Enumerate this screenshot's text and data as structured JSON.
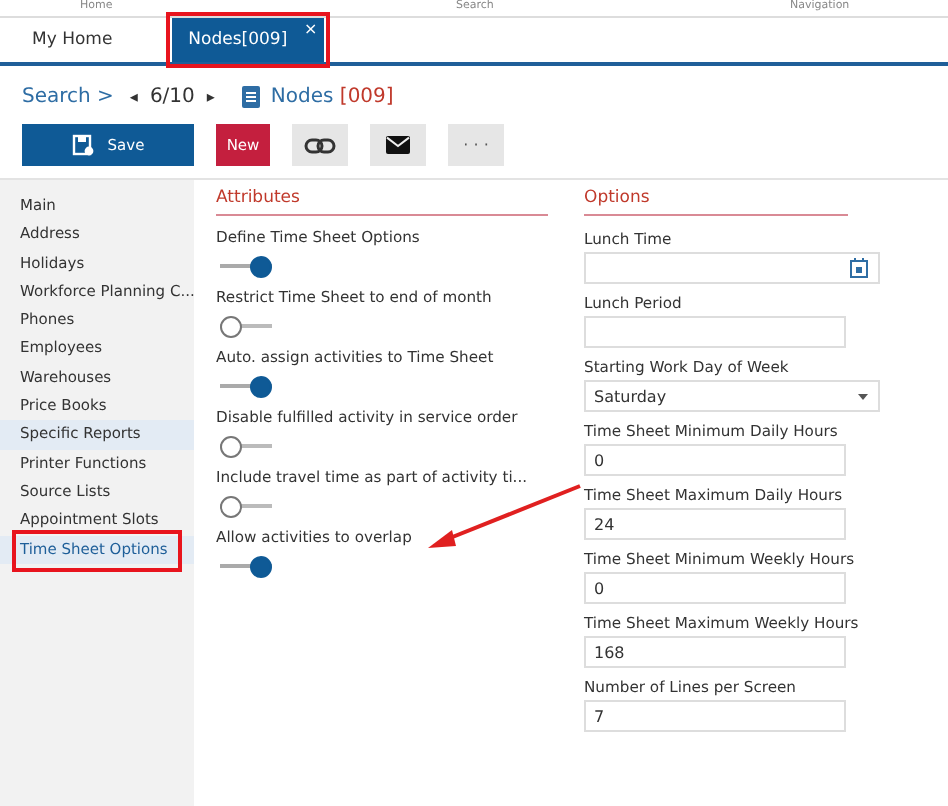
{
  "ribbon_groups": [
    "Home",
    "Search",
    "Navigation"
  ],
  "tabs": [
    {
      "label": "My Home",
      "selected": false
    },
    {
      "label": "Nodes[009]",
      "selected": true,
      "close_glyph": "×"
    }
  ],
  "breadcrumb": {
    "link": "Search >",
    "prev": "◂",
    "position": "6/10",
    "next": "▸",
    "title": "Nodes",
    "code": "[009]"
  },
  "toolbar": [
    {
      "kind": "save",
      "label": "Save"
    },
    {
      "kind": "new",
      "label": "New"
    },
    {
      "kind": "link"
    },
    {
      "kind": "mail"
    },
    {
      "kind": "more",
      "label": "· · ·"
    }
  ],
  "sidebar": {
    "items": [
      {
        "label": "Main",
        "selected": false,
        "hovered": false
      },
      {
        "label": "Address",
        "selected": false,
        "hovered": false
      },
      {
        "label": "Holidays",
        "selected": false,
        "hovered": false
      },
      {
        "label": "Workforce Planning C...",
        "selected": false,
        "hovered": false
      },
      {
        "label": "Phones",
        "selected": false,
        "hovered": false
      },
      {
        "label": "Employees",
        "selected": false,
        "hovered": false
      },
      {
        "label": "Warehouses",
        "selected": false,
        "hovered": false
      },
      {
        "label": "Price Books",
        "selected": false,
        "hovered": false
      },
      {
        "label": "Specific Reports",
        "selected": false,
        "hovered": true
      },
      {
        "label": "Printer Functions",
        "selected": false,
        "hovered": false
      },
      {
        "label": "Source Lists",
        "selected": false,
        "hovered": false
      },
      {
        "label": "Appointment Slots",
        "selected": false,
        "hovered": false
      },
      {
        "label": "Time Sheet Options",
        "selected": true,
        "hovered": false,
        "highlighted": true
      }
    ]
  },
  "attributes": {
    "title": "Attributes",
    "items": [
      {
        "label": "Define Time Sheet Options",
        "on": true
      },
      {
        "label": "Restrict Time Sheet to end of month",
        "on": false
      },
      {
        "label": "Auto. assign activities to Time Sheet",
        "on": true
      },
      {
        "label": "Disable fulfilled activity in service order",
        "on": false
      },
      {
        "label": "Include travel time as part of activity ti...",
        "on": false
      },
      {
        "label": "Allow activities to overlap",
        "on": true,
        "highlighted": true
      }
    ]
  },
  "options": {
    "title": "Options",
    "fields": [
      {
        "kind": "time",
        "label": "Lunch Time"
      },
      {
        "kind": "text",
        "label": "Lunch Period"
      },
      {
        "kind": "select",
        "label": "Starting Work Day of Week",
        "value": "Saturday"
      },
      {
        "kind": "text",
        "label": "Time Sheet Minimum Daily Hours",
        "value": "0"
      },
      {
        "kind": "text",
        "label": "Time Sheet Maximum Daily Hours",
        "value": "24"
      },
      {
        "kind": "text",
        "label": "Time Sheet Minimum Weekly Hours",
        "value": "0"
      },
      {
        "kind": "text",
        "label": "Time Sheet Maximum Weekly Hours",
        "value": "168"
      },
      {
        "kind": "text",
        "label": "Number of Lines per Screen",
        "value": "7"
      }
    ]
  }
}
